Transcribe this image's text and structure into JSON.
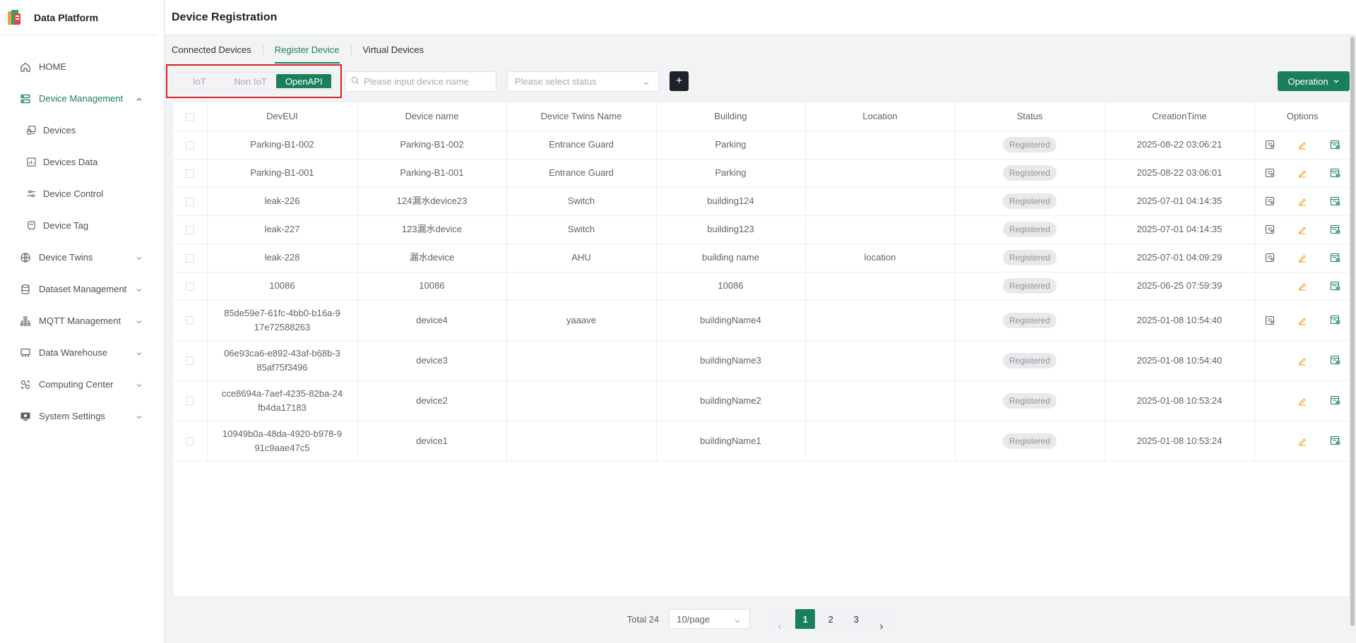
{
  "app": {
    "title": "Data Platform"
  },
  "sidebar": {
    "items": [
      {
        "label": "HOME",
        "icon": "home-icon"
      },
      {
        "label": "Device Management",
        "icon": "server-icon",
        "expanded": true
      },
      {
        "label": "Devices",
        "icon": "devices-icon"
      },
      {
        "label": "Devices Data",
        "icon": "chart-doc-icon"
      },
      {
        "label": "Device Control",
        "icon": "sliders-icon"
      },
      {
        "label": "Device Tag",
        "icon": "tag-icon"
      },
      {
        "label": "Device Twins",
        "icon": "globe-icon"
      },
      {
        "label": "Dataset Management",
        "icon": "database-icon"
      },
      {
        "label": "MQTT Management",
        "icon": "network-icon"
      },
      {
        "label": "Data Warehouse",
        "icon": "easel-icon"
      },
      {
        "label": "Computing Center",
        "icon": "compute-icon"
      },
      {
        "label": "System Settings",
        "icon": "monitor-icon"
      }
    ]
  },
  "header": {
    "title": "Device Registration"
  },
  "tabs": [
    {
      "label": "Connected Devices"
    },
    {
      "label": "Register Device",
      "active": true
    },
    {
      "label": "Virtual Devices"
    }
  ],
  "toolbar": {
    "segments": [
      "IoT",
      "Non IoT",
      "OpenAPI"
    ],
    "selected_segment": "OpenAPI",
    "search_placeholder": "Please input device name",
    "status_placeholder": "Please select status",
    "add_label": "+",
    "operation_label": "Operation"
  },
  "table": {
    "columns": [
      "DevEUI",
      "Device name",
      "Device Twins Name",
      "Building",
      "Location",
      "Status",
      "CreationTime",
      "Options"
    ],
    "rows": [
      {
        "deveui": "Parking-B1-002",
        "name": "Parking-B1-002",
        "twins": "Entrance Guard",
        "building": "Parking",
        "location": "",
        "status": "Registered",
        "time": "2025-08-22 03:06:21",
        "has_detail": true
      },
      {
        "deveui": "Parking-B1-001",
        "name": "Parking-B1-001",
        "twins": "Entrance Guard",
        "building": "Parking",
        "location": "",
        "status": "Registered",
        "time": "2025-08-22 03:06:01",
        "has_detail": true
      },
      {
        "deveui": "leak-226",
        "name": "124漏水device23",
        "twins": "Switch",
        "building": "building124",
        "location": "",
        "status": "Registered",
        "time": "2025-07-01 04:14:35",
        "has_detail": true
      },
      {
        "deveui": "leak-227",
        "name": "123漏水device",
        "twins": "Switch",
        "building": "building123",
        "location": "",
        "status": "Registered",
        "time": "2025-07-01 04:14:35",
        "has_detail": true
      },
      {
        "deveui": "leak-228",
        "name": "漏水device",
        "twins": "AHU",
        "building": "building name",
        "location": "location",
        "status": "Registered",
        "time": "2025-07-01 04:09:29",
        "has_detail": true
      },
      {
        "deveui": "10086",
        "name": "10086",
        "twins": "",
        "building": "10086",
        "location": "",
        "status": "Registered",
        "time": "2025-06-25 07:59:39",
        "has_detail": false
      },
      {
        "deveui": "85de59e7-61fc-4bb0-b16a-917e72588263",
        "name": "device4",
        "twins": "yaaave",
        "building": "buildingName4",
        "location": "",
        "status": "Registered",
        "time": "2025-01-08 10:54:40",
        "has_detail": true
      },
      {
        "deveui": "06e93ca6-e892-43af-b68b-385af75f3496",
        "name": "device3",
        "twins": "",
        "building": "buildingName3",
        "location": "",
        "status": "Registered",
        "time": "2025-01-08 10:54:40",
        "has_detail": false
      },
      {
        "deveui": "cce8694a-7aef-4235-82ba-24fb4da17183",
        "name": "device2",
        "twins": "",
        "building": "buildingName2",
        "location": "",
        "status": "Registered",
        "time": "2025-01-08 10:53:24",
        "has_detail": false
      },
      {
        "deveui": "10949b0a-48da-4920-b978-991c9aae47c5",
        "name": "device1",
        "twins": "",
        "building": "buildingName1",
        "location": "",
        "status": "Registered",
        "time": "2025-01-08 10:53:24",
        "has_detail": false
      }
    ]
  },
  "pagination": {
    "total_label": "Total 24",
    "page_size": "10/page",
    "pages": [
      "1",
      "2",
      "3"
    ],
    "current": "1"
  },
  "colors": {
    "accent": "#1a7f5a",
    "highlight": "#e02020",
    "edit": "#f5a623"
  }
}
